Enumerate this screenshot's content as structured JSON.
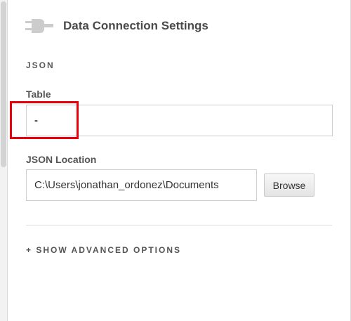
{
  "header": {
    "title": "Data Connection Settings",
    "icon": "plug-icon"
  },
  "section": {
    "label": "JSON"
  },
  "table_field": {
    "label": "Table",
    "value": "-"
  },
  "json_location_field": {
    "label": "JSON Location",
    "value": "C:\\Users\\jonathan_ordonez\\Documents"
  },
  "browse_button": {
    "label": "Browse"
  },
  "advanced_options": {
    "label": "+ SHOW ADVANCED OPTIONS"
  },
  "colors": {
    "highlight": "#e8000b",
    "icon": "#cccccc",
    "title": "#4a4a4a"
  }
}
